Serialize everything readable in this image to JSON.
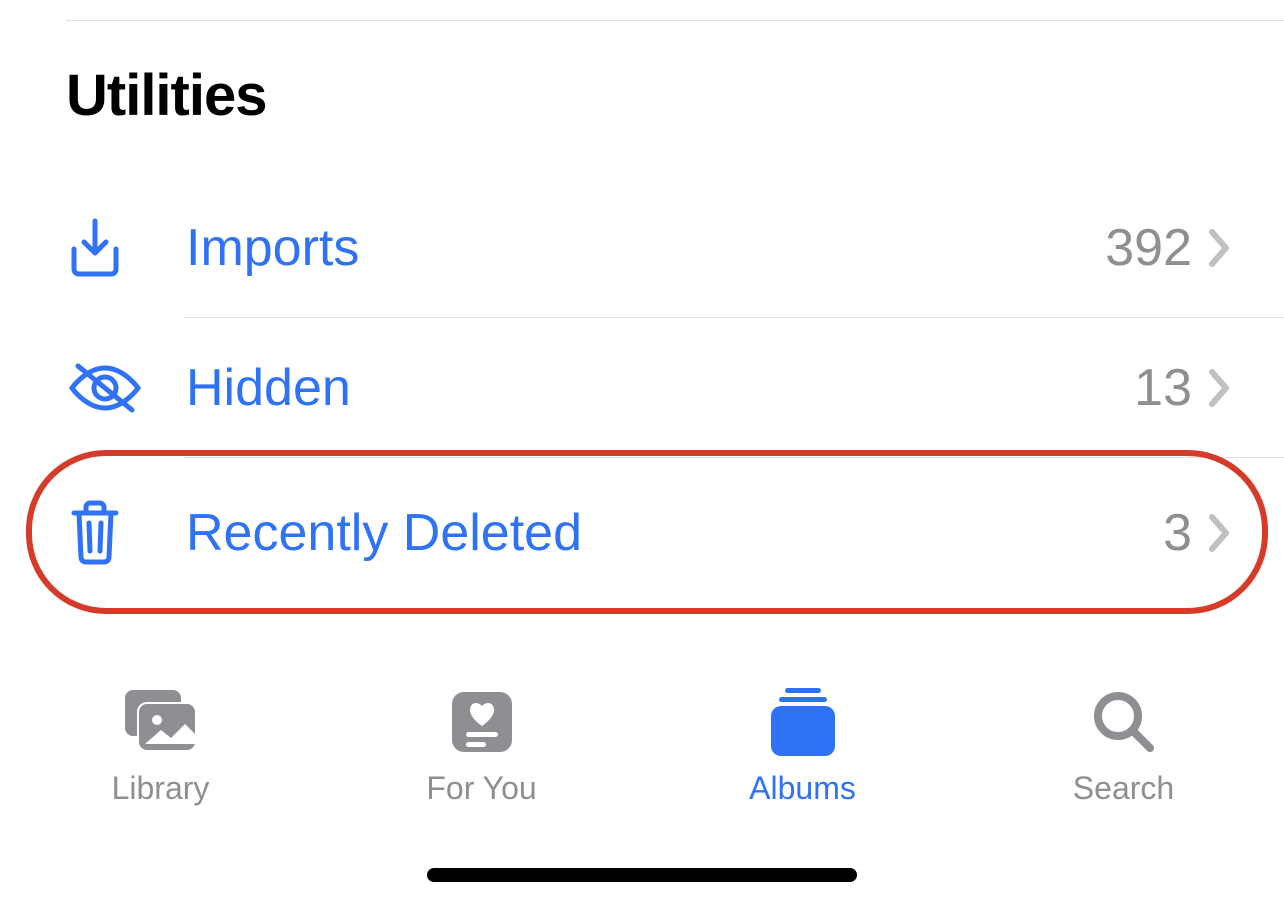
{
  "section": {
    "title": "Utilities",
    "rows": [
      {
        "label": "Imports",
        "count": "392"
      },
      {
        "label": "Hidden",
        "count": "13"
      },
      {
        "label": "Recently Deleted",
        "count": "3"
      }
    ]
  },
  "tabs": {
    "library": "Library",
    "foryou": "For You",
    "albums": "Albums",
    "search": "Search"
  },
  "colors": {
    "accent": "#2f72f6",
    "inactive": "#8e8e93",
    "highlight": "#d63b2a"
  }
}
